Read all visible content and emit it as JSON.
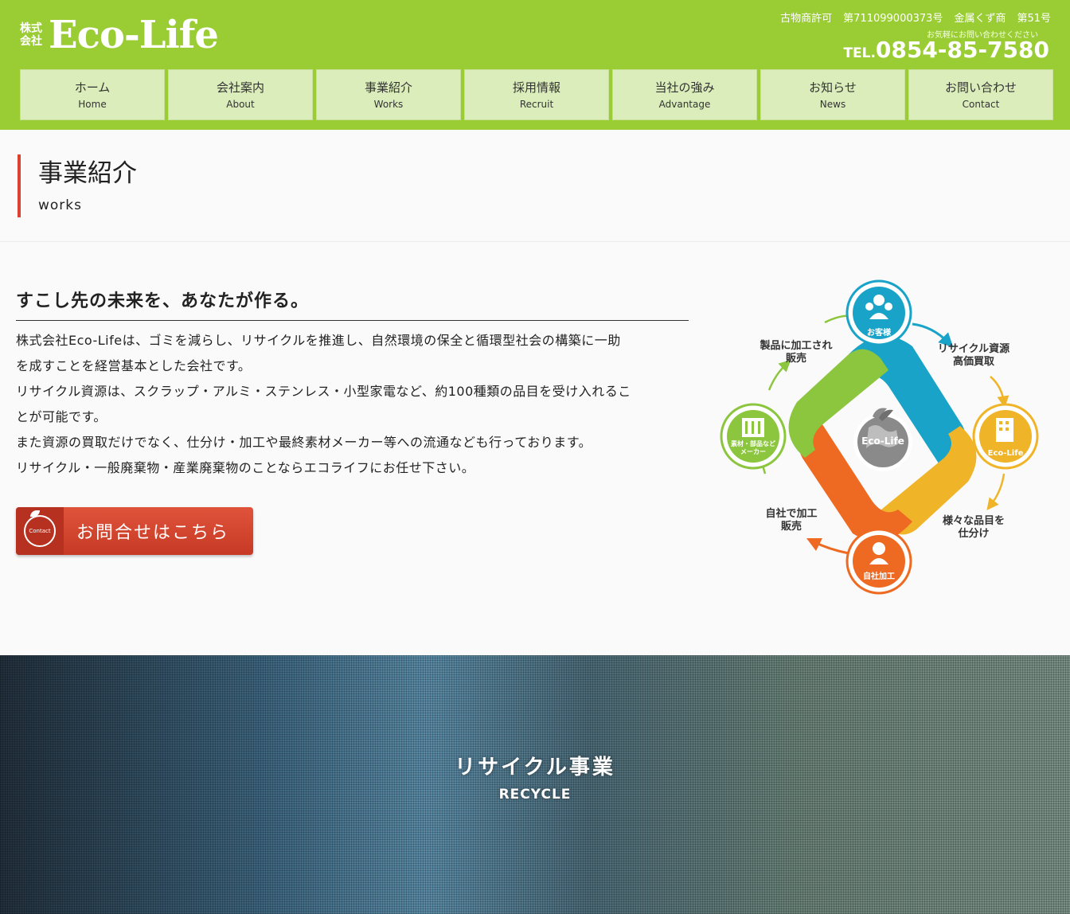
{
  "header": {
    "logo_prefix": "株式会社",
    "logo_name": "Eco-Life",
    "license": [
      "古物商許可",
      "第711099000373号",
      "金属くず商",
      "第51号"
    ],
    "tel_note": "お気軽にお問い合わせください",
    "tel_prefix": "TEL.",
    "tel_number": "0854-85-7580",
    "brand_color": "#9acd34"
  },
  "nav": [
    {
      "jp": "ホーム",
      "en": "Home"
    },
    {
      "jp": "会社案内",
      "en": "About"
    },
    {
      "jp": "事業紹介",
      "en": "Works"
    },
    {
      "jp": "採用情報",
      "en": "Recruit"
    },
    {
      "jp": "当社の強み",
      "en": "Advantage"
    },
    {
      "jp": "お知らせ",
      "en": "News"
    },
    {
      "jp": "お問い合わせ",
      "en": "Contact"
    }
  ],
  "page_title": {
    "main": "事業紹介",
    "sub": "works",
    "accent_color": "#d9422e"
  },
  "intro": {
    "heading": "すこし先の未来を、あなたが作る。",
    "paragraphs": [
      "株式会社Eco-Lifeは、ゴミを減らし、リサイクルを推進し、自然環境の保全と循環型社会の構築に一助",
      "を成すことを経営基本とした会社です。",
      "リサイクル資源は、スクラップ・アルミ・ステンレス・小型家電など、約100種類の品目を受け入れるこ",
      "とが可能です。",
      "また資源の買取だけでなく、仕分け・加工や最終素材メーカー等への流通なども行っております。",
      "リサイクル・一般廃棄物・産業廃棄物のことならエコライフにお任せ下さい。"
    ]
  },
  "contact_button": {
    "badge": "Contact",
    "label": "お問合せはこちら",
    "color": "#d9442f"
  },
  "diagram": {
    "center": "Eco-Life",
    "nodes": {
      "top": "お客様",
      "right": "Eco-Life",
      "bottom": "自社加工",
      "left_line1": "素材・部品など",
      "left_line2": "メーカー"
    },
    "labels": {
      "top_right": [
        "リサイクル資源",
        "高価買取"
      ],
      "bottom_right": [
        "様々な品目を",
        "仕分け"
      ],
      "bottom_left": [
        "自社で加工",
        "販売"
      ],
      "top_left": [
        "製品に加工され",
        "販売"
      ]
    },
    "colors": {
      "blue": "#1aa3c8",
      "yellow": "#f0b429",
      "orange": "#ee6a22",
      "green": "#8cc63f"
    }
  },
  "hero": {
    "title": "リサイクル事業",
    "subtitle": "RECYCLE"
  }
}
